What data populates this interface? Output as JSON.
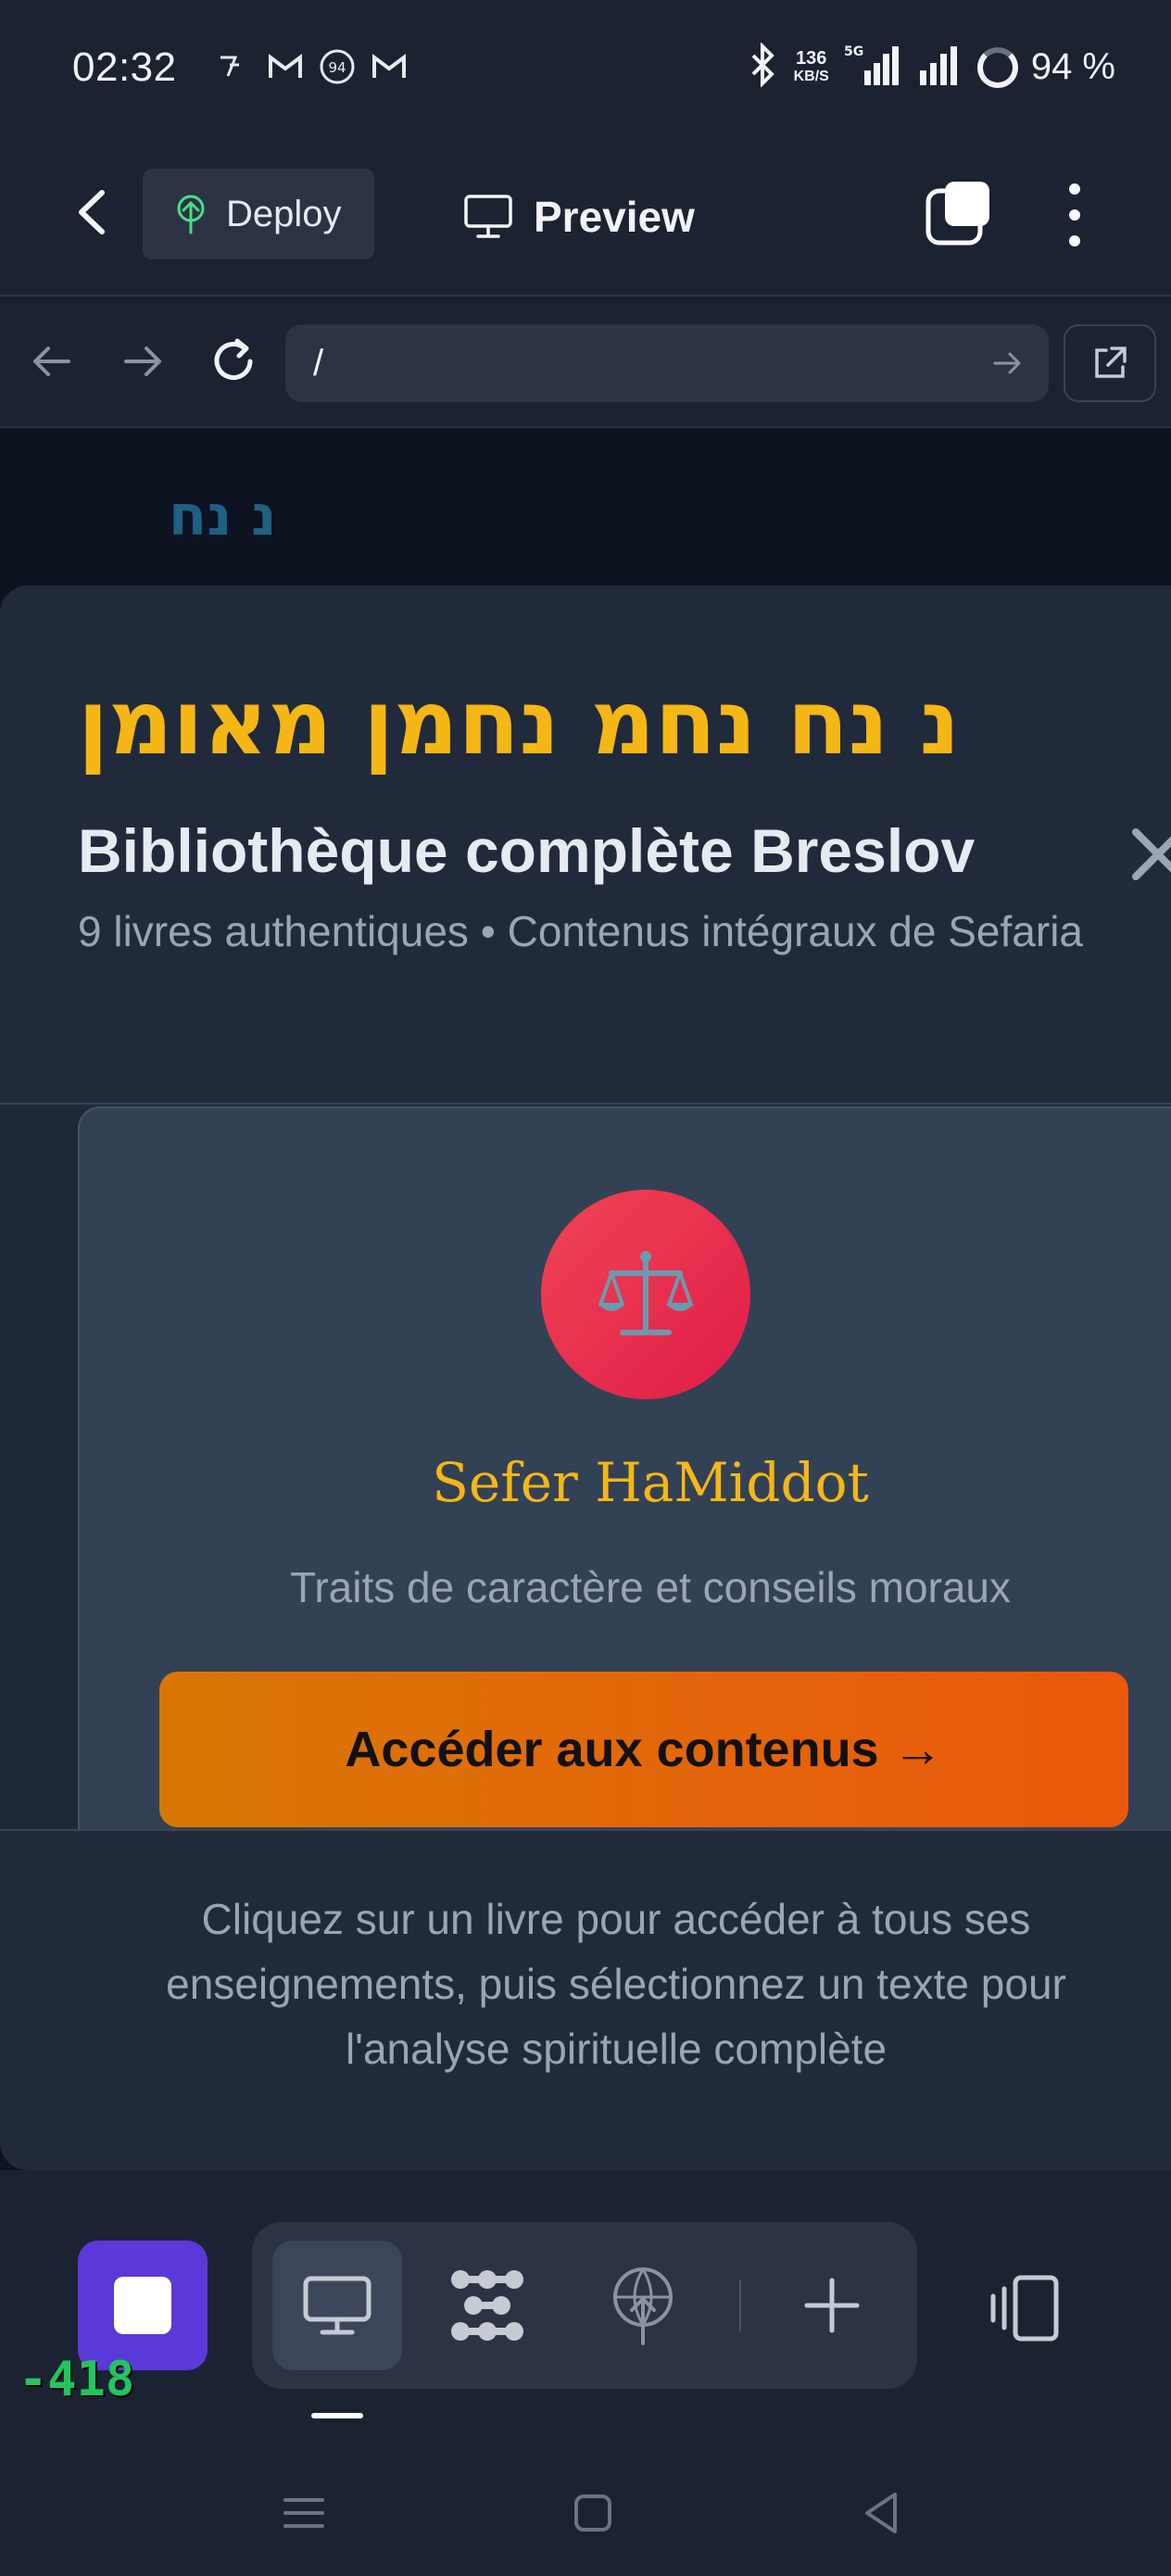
{
  "status_bar": {
    "time": "02:32",
    "net_speed": "136",
    "net_unit": "KB/S",
    "network": "5G",
    "battery": "94 %"
  },
  "app_bar": {
    "deploy_label": "Deploy",
    "preview_label": "Preview"
  },
  "url_bar": {
    "url": "/"
  },
  "site": {
    "logo": "נ נח"
  },
  "modal": {
    "hebrew_title": "נ נח נחמ נחמן מאומן",
    "title": "Bibliothèque complète Breslov",
    "subtitle": "9 livres authentiques • Contenus intégraux de Sefaria",
    "book": {
      "icon": "⚖️",
      "title": "Sefer HaMiddot",
      "description": "Traits de caractère et conseils moraux",
      "button_label": "Accéder aux contenus →"
    },
    "footer_text": "Cliquez sur un livre pour accéder à tous ses enseignements, puis sélectionnez un texte pour l'analyse spirituelle complète"
  },
  "bottom_bar": {
    "counter": "-418"
  },
  "colors": {
    "accent_gold": "#f5b716",
    "button_orange_start": "#d97706",
    "button_orange_end": "#ea580c",
    "stop_purple": "#5b39d8",
    "icon_circle": "#e11d48"
  }
}
